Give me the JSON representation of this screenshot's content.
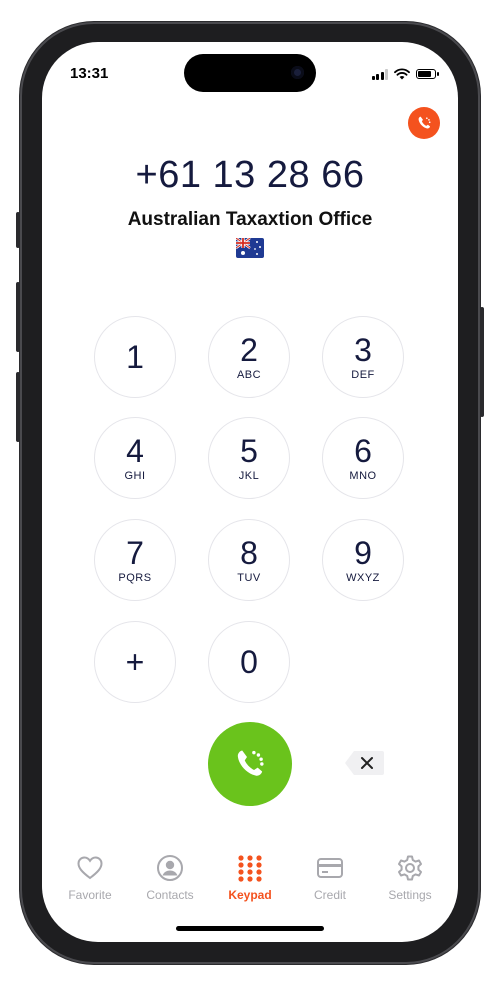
{
  "status_bar": {
    "time": "13:31"
  },
  "dialer": {
    "number": "+61 13 28 66",
    "contact_name": "Australian Taxaxtion Office",
    "country_flag": "australia-flag-icon"
  },
  "keypad": {
    "keys": [
      {
        "digit": "1",
        "letters": ""
      },
      {
        "digit": "2",
        "letters": "ABC"
      },
      {
        "digit": "3",
        "letters": "DEF"
      },
      {
        "digit": "4",
        "letters": "GHI"
      },
      {
        "digit": "5",
        "letters": "JKL"
      },
      {
        "digit": "6",
        "letters": "MNO"
      },
      {
        "digit": "7",
        "letters": "PQRS"
      },
      {
        "digit": "8",
        "letters": "TUV"
      },
      {
        "digit": "9",
        "letters": "WXYZ"
      },
      {
        "digit": "+",
        "letters": ""
      },
      {
        "digit": "0",
        "letters": ""
      }
    ]
  },
  "tabs": [
    {
      "label": "Favorite",
      "icon": "heart-icon",
      "active": false
    },
    {
      "label": "Contacts",
      "icon": "person-icon",
      "active": false
    },
    {
      "label": "Keypad",
      "icon": "keypad-grid-icon",
      "active": true
    },
    {
      "label": "Credit",
      "icon": "credit-card-icon",
      "active": false
    },
    {
      "label": "Settings",
      "icon": "gear-icon",
      "active": false
    }
  ],
  "colors": {
    "accent": "#f4521e",
    "call_green": "#6ac31c",
    "text_dark": "#151a3e",
    "inactive": "#a8a8ad"
  }
}
